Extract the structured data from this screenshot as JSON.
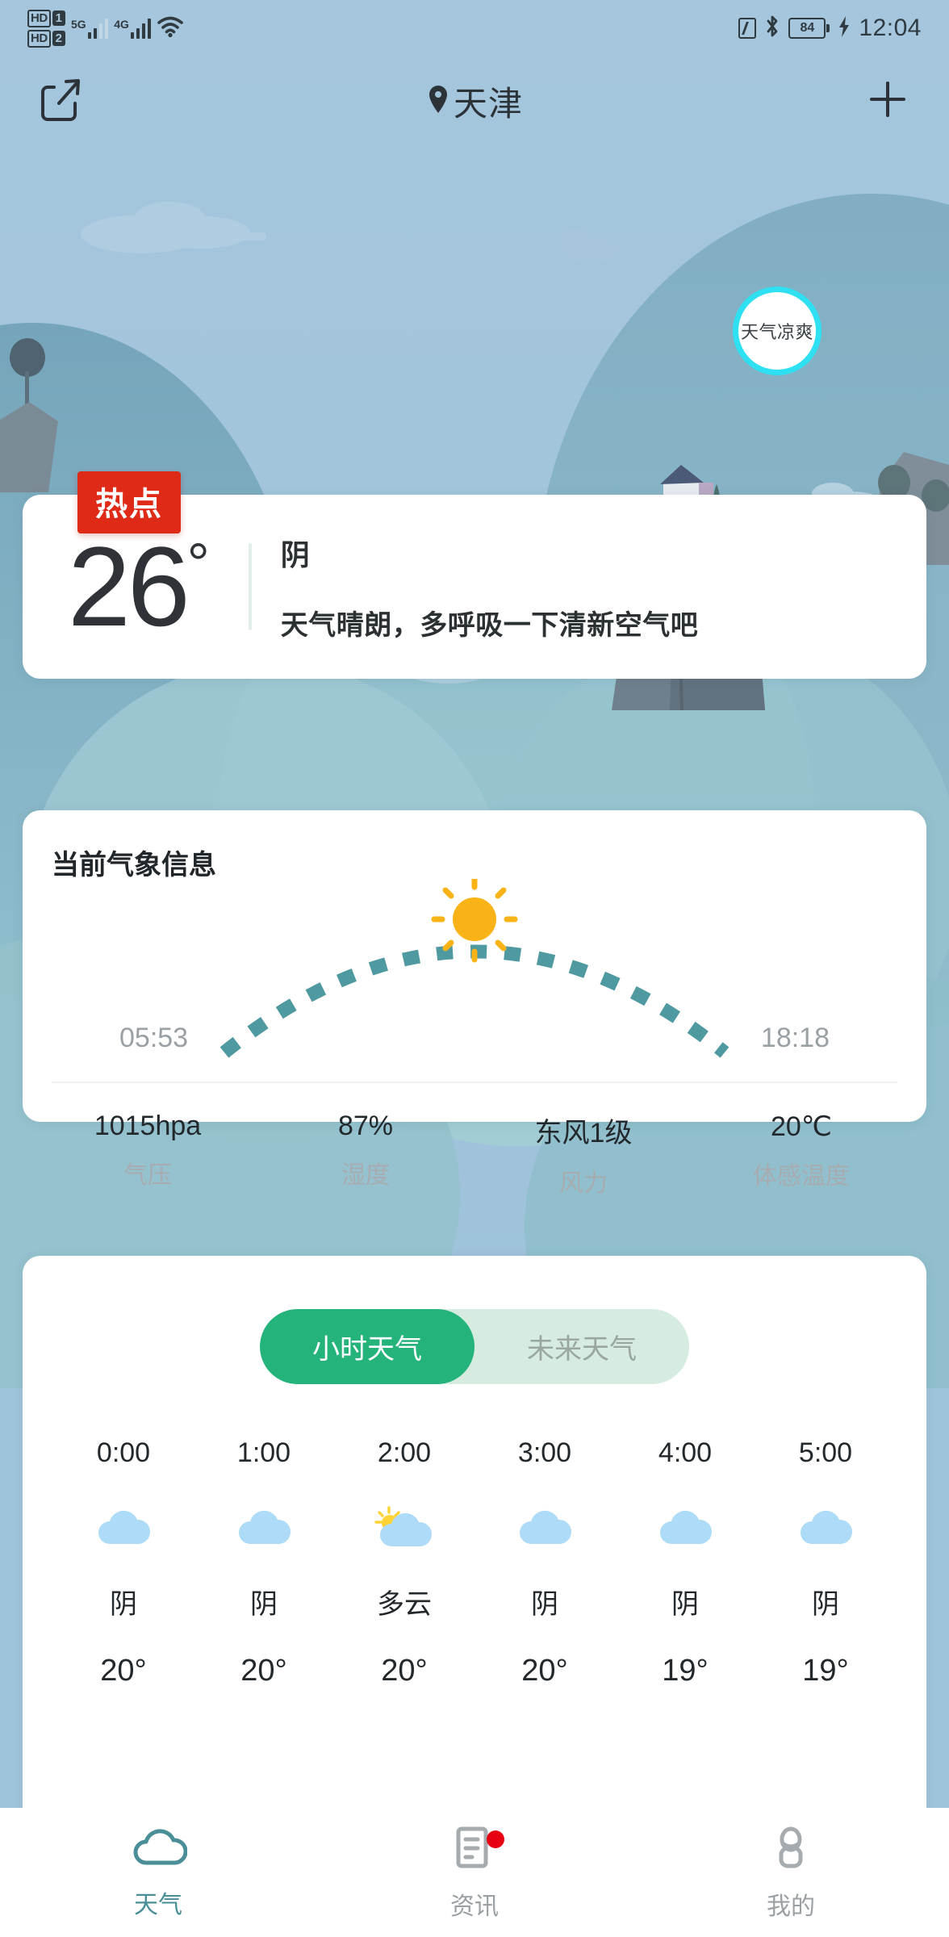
{
  "status_bar": {
    "hd1_label": "HD",
    "hd1_num": "1",
    "hd2_label": "HD",
    "hd2_num": "2",
    "sim1_network": "5G",
    "sim2_network": "4G",
    "wifi_icon": "wifi-icon",
    "nfc_icon": "nfc-icon",
    "bluetooth_icon": "bluetooth-icon",
    "battery_level": "84",
    "charging_icon": "charging-bolt-icon",
    "time": "12:04"
  },
  "app_bar": {
    "share_icon": "share-icon",
    "location_icon": "location-pin-icon",
    "city": "天津",
    "add_icon": "plus-icon"
  },
  "hot_badge": {
    "label": "热点"
  },
  "cool_badge": {
    "label": "天气凉爽",
    "ring_color": "#2ee0f2"
  },
  "current": {
    "temperature": "26",
    "degree_symbol": "°",
    "condition": "阴",
    "tip": "天气晴朗，多呼吸一下清新空气吧"
  },
  "meteo": {
    "title": "当前气象信息",
    "sun_icon": "sun-icon",
    "sunrise": "05:53",
    "sunset": "18:18",
    "arc_color": "#4f9aa0",
    "sun_color": "#f9b316",
    "metrics": [
      {
        "value": "1015hpa",
        "label": "气压"
      },
      {
        "value": "87%",
        "label": "湿度"
      },
      {
        "value": "东风1级",
        "label": "风力"
      },
      {
        "value": "20℃",
        "label": "体感温度"
      }
    ]
  },
  "forecast": {
    "tabs": [
      {
        "label": "小时天气",
        "active": true
      },
      {
        "label": "未来天气",
        "active": false
      }
    ],
    "active_color": "#25b37c",
    "track_color": "#d6ece0",
    "hours": [
      {
        "time": "0:00",
        "icon": "cloud-icon",
        "condition": "阴",
        "temp": "20°"
      },
      {
        "time": "1:00",
        "icon": "cloud-icon",
        "condition": "阴",
        "temp": "20°"
      },
      {
        "time": "2:00",
        "icon": "sun-cloud-icon",
        "condition": "多云",
        "temp": "20°"
      },
      {
        "time": "3:00",
        "icon": "cloud-icon",
        "condition": "阴",
        "temp": "20°"
      },
      {
        "time": "4:00",
        "icon": "cloud-icon",
        "condition": "阴",
        "temp": "19°"
      },
      {
        "time": "5:00",
        "icon": "cloud-icon",
        "condition": "阴",
        "temp": "19°"
      }
    ]
  },
  "bottom_nav": [
    {
      "label": "天气",
      "icon": "cloud-outline-icon",
      "active": true,
      "badge": false
    },
    {
      "label": "资讯",
      "icon": "news-icon",
      "active": false,
      "badge": true
    },
    {
      "label": "我的",
      "icon": "person-icon",
      "active": false,
      "badge": false
    }
  ],
  "theme": {
    "sky": "#9fc3da",
    "hill": "#7ba9c2",
    "card": "#ffffff",
    "hot_red": "#e02a18"
  }
}
